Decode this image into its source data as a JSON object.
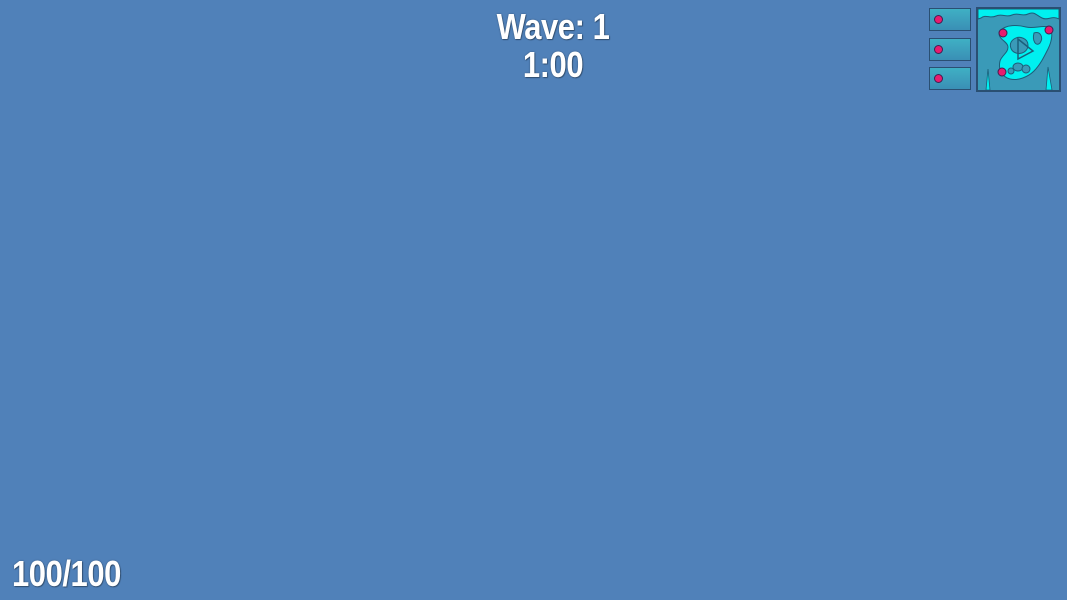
{
  "hud": {
    "wave_label": "Wave: 1",
    "wave_timer": "1:00",
    "health_text": "100/100"
  },
  "health": {
    "current": 100,
    "max": 100
  },
  "wave": {
    "number": 1,
    "time_remaining": "1:00"
  },
  "slots": [
    {
      "icon": "pink-dot-icon",
      "color": "#e81c6e"
    },
    {
      "icon": "pink-dot-icon",
      "color": "#e81c6e"
    },
    {
      "icon": "pink-dot-icon",
      "color": "#e81c6e"
    }
  ],
  "minimap": {
    "terrain_color": "#00f0f0",
    "water_color": "#3a9ab8",
    "marker_color": "#e81c6e",
    "player_icon": "player-arrow-icon"
  },
  "colors": {
    "background": "#5081b9",
    "text": "#ffffff",
    "panel_border": "#2a4f72"
  }
}
